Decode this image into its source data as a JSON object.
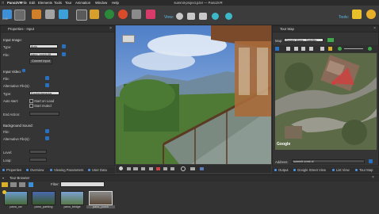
{
  "app": {
    "menu": [
      "Pano2VR",
      "File",
      "Edit",
      "Elements",
      "Tools",
      "Tour",
      "Animation",
      "Window",
      "Help"
    ],
    "window_title": "summit-project.p2vr — Pano2VR"
  },
  "toolbar": {
    "view_label": "View:",
    "tools_label": "Tools:",
    "edit_label": "Edit:",
    "icons": [
      "input-icon",
      "output-icon",
      "hotspots-icon",
      "patch-icon",
      "lens-flare-icon",
      "sound-icon",
      "images-icon",
      "gallery-icon",
      "skin-icon",
      "viewer-icon",
      "tour-icon",
      "stop-icon",
      "settings-icon",
      "tools-icon",
      "editor-icon"
    ]
  },
  "properties": {
    "title": "Properties - Input",
    "input_image_label": "Input Image:",
    "type_label": "Type:",
    "type_value": "Auto",
    "file_label": "File:",
    "file_value": "pano_porch.tiff",
    "convert_label": "Convert Input",
    "input_video_label": "Input Video:",
    "video_file_label": "File:",
    "alt_files_label": "Alternative File(s):",
    "video_type_label": "Type:",
    "video_type_value": "Equirectangular",
    "auto_start_label": "Auto start:",
    "start_on_load": "Start on Load",
    "start_muted": "Start muted",
    "end_action_label": "End Action:",
    "bg_sound_label": "Background Sound:",
    "sound_file_label": "File:",
    "sound_alt_label": "Alternative File(s):",
    "level_label": "Level:",
    "loop_label": "Loop:"
  },
  "left_tabs": [
    "Properties",
    "Overview",
    "Viewing Parameters",
    "User Data"
  ],
  "tour_map": {
    "title": "Tour Map",
    "map_label": "Map:",
    "map_value": "Google Maps - Satellite",
    "address_label": "Address:",
    "address_value": "summit crest ct",
    "google_logo": "Google"
  },
  "right_tabs": [
    "Output",
    "Google Street View",
    "List View",
    "Tour Map"
  ],
  "tour_browser": {
    "title": "Tour Browser",
    "filter_label": "Filter:",
    "items": [
      "pano_cw",
      "pano_parking",
      "pano_bridge",
      "pano_porch"
    ],
    "colors": [
      "#8ab0d0",
      "#6a8ab8",
      "#7aa0c8",
      "#b8b8b8"
    ]
  },
  "colors": {
    "accent": "#5fb8e8",
    "selection": "#2a70c0"
  }
}
